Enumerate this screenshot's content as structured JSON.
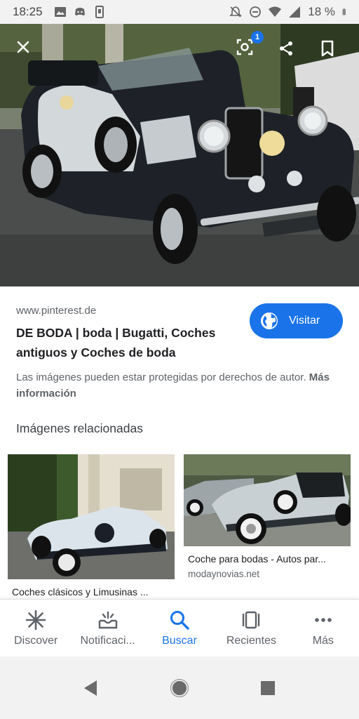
{
  "status_bar": {
    "time": "18:25",
    "battery": "18 %",
    "icons_left": [
      "image-icon",
      "discord-icon",
      "phone-icon"
    ],
    "icons_right": [
      "mute-icon",
      "dnd-icon",
      "wifi-icon",
      "signal-icon",
      "battery-icon"
    ]
  },
  "hero": {
    "lens_badge": "1"
  },
  "result": {
    "domain": "www.pinterest.de",
    "title": "DE BODA | boda | Bugatti, Coches antiguos y Coches de boda",
    "visit_label": "Visitar",
    "copyright_text": "Las imágenes pueden estar protegidas por derechos de autor.",
    "more_info": "Más información"
  },
  "related": {
    "heading": "Imágenes relacionadas",
    "items": [
      {
        "caption": "Coches clásicos y Limusinas ...",
        "source": ""
      },
      {
        "caption": "Coche para bodas - Autos par...",
        "source": "modaynovias.net"
      }
    ]
  },
  "bottom_nav": {
    "items": [
      {
        "label": "Discover",
        "icon": "asterisk-icon"
      },
      {
        "label": "Notificaci...",
        "icon": "notifications-icon"
      },
      {
        "label": "Buscar",
        "icon": "search-icon"
      },
      {
        "label": "Recientes",
        "icon": "recents-icon"
      },
      {
        "label": "Más",
        "icon": "more-icon"
      }
    ],
    "active": "Buscar"
  },
  "colors": {
    "accent": "#1a73e8",
    "text_primary": "#202124",
    "text_secondary": "#5f6368"
  }
}
